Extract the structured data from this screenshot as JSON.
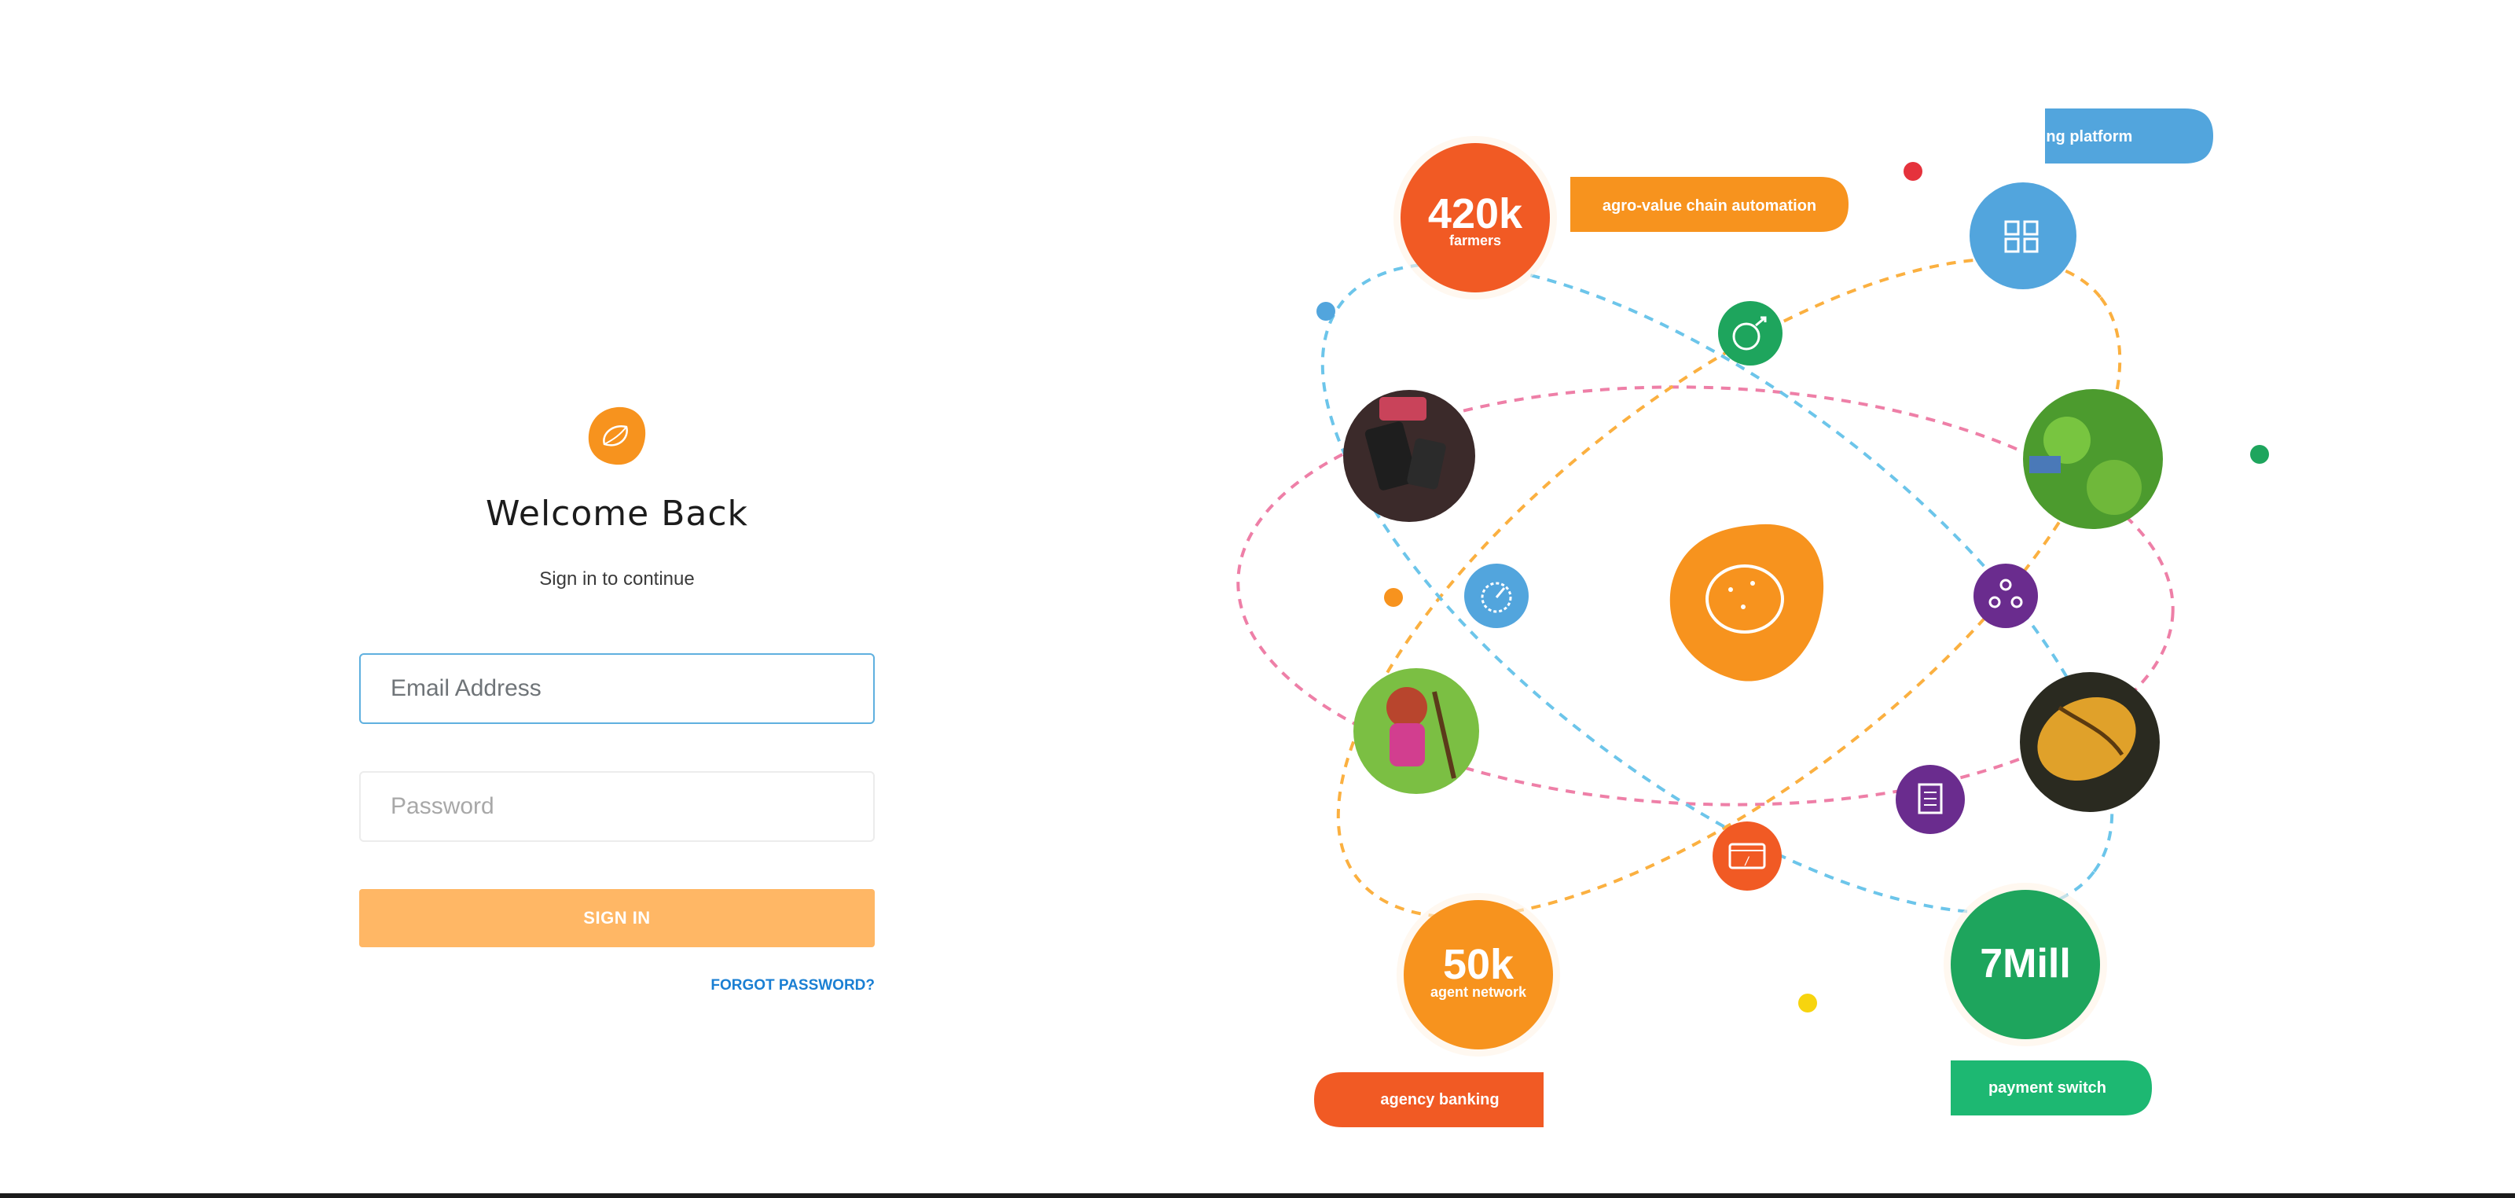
{
  "login": {
    "title": "Welcome Back",
    "subtitle": "Sign in to continue",
    "email_placeholder": "Email Address",
    "password_placeholder": "Password",
    "submit_label": "SIGN IN",
    "forgot_label": "FORGOT PASSWORD?"
  },
  "illustration": {
    "stats": [
      {
        "value": "420k",
        "caption": "farmers"
      },
      {
        "value": "50k",
        "caption": "agent network"
      },
      {
        "value": "7Mill"
      }
    ],
    "tags": {
      "agro": "agro-value chain automation",
      "lending": "lending platform",
      "agency": "agency banking",
      "payment": "payment switch"
    }
  },
  "colors": {
    "orange": "#f7931e",
    "red_orange": "#f15a24",
    "blue": "#52a5dd",
    "green": "#1ea55d",
    "purple": "#6a2c8e",
    "pink_dash": "#ee7fa7"
  }
}
